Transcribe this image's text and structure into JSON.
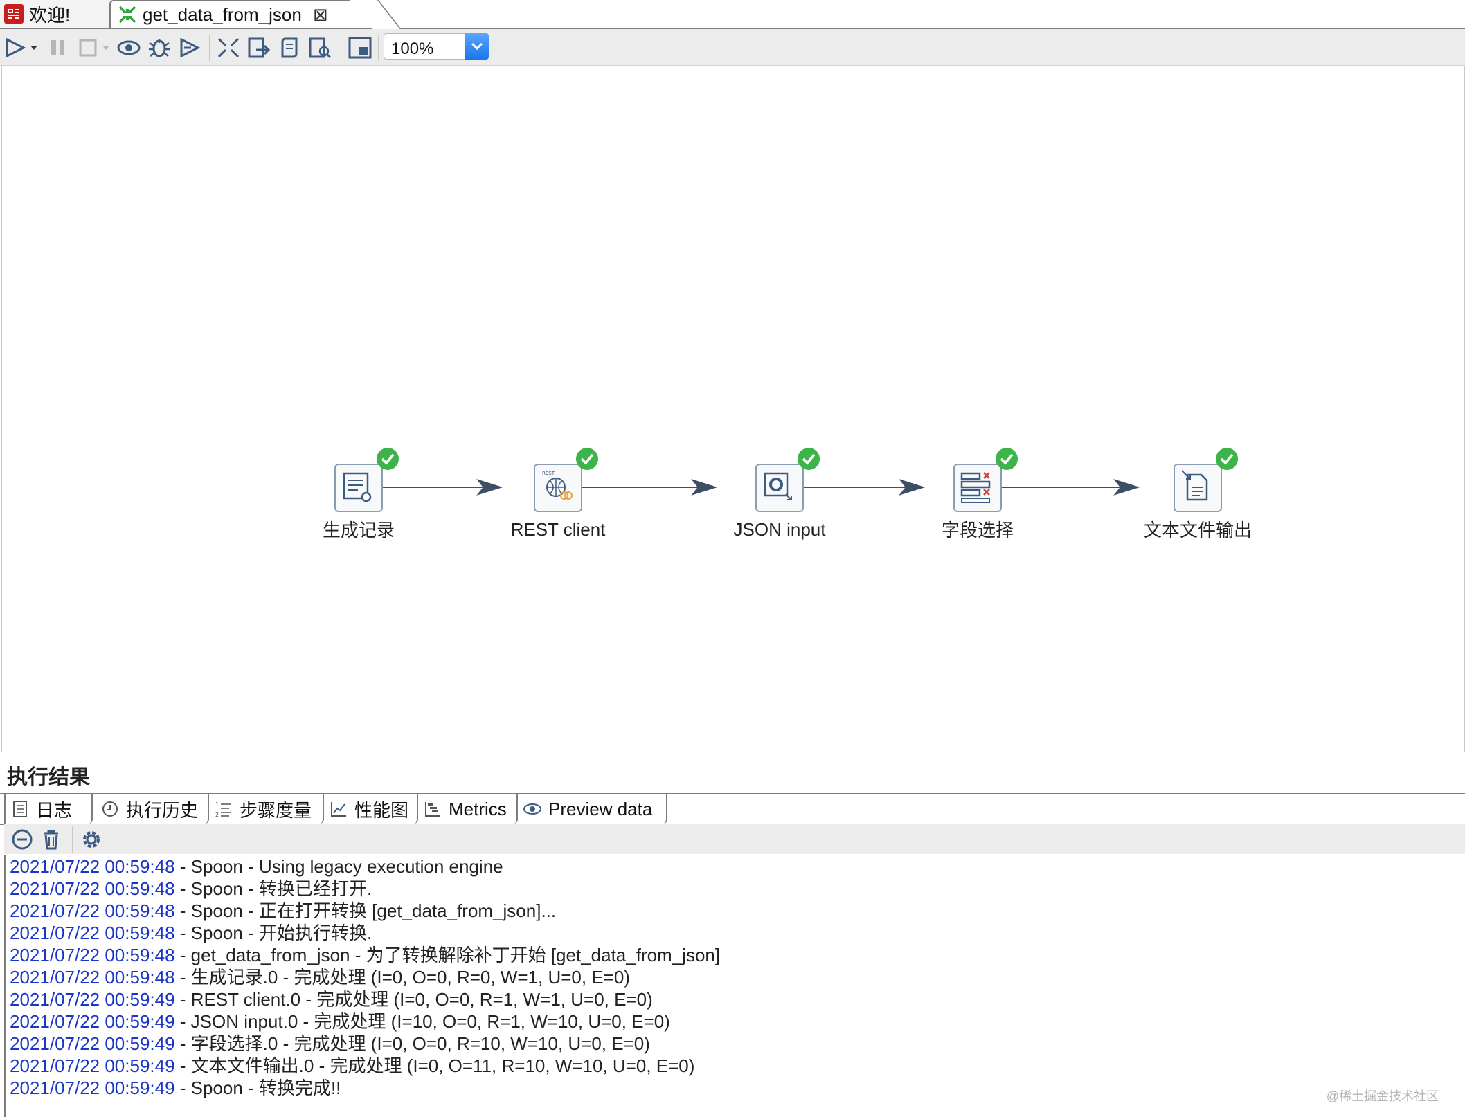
{
  "tabs": {
    "welcome": "欢迎!",
    "transformation": "get_data_from_json",
    "close_glyph": "⊠"
  },
  "toolbar": {
    "zoom_value": "100%",
    "buttons": [
      "run",
      "pause",
      "stop",
      "preview",
      "debug",
      "replay",
      "verify",
      "impact",
      "sql",
      "explore-db",
      "show-results"
    ]
  },
  "canvas": {
    "steps": [
      {
        "id": "generate-rows",
        "label": "生成记录",
        "status": "success"
      },
      {
        "id": "rest-client",
        "label": "REST client",
        "status": "success"
      },
      {
        "id": "json-input",
        "label": "JSON input",
        "status": "success"
      },
      {
        "id": "select-values",
        "label": "字段选择",
        "status": "success"
      },
      {
        "id": "text-file-output",
        "label": "文本文件输出",
        "status": "success"
      }
    ]
  },
  "results": {
    "title": "执行结果",
    "tabs": [
      "日志",
      "执行历史",
      "步骤度量",
      "性能图",
      "Metrics",
      "Preview data"
    ],
    "log": [
      {
        "ts": "2021/07/22 00:59:48",
        "msg": " - Spoon - Using legacy execution engine"
      },
      {
        "ts": "2021/07/22 00:59:48",
        "msg": " - Spoon - 转换已经打开."
      },
      {
        "ts": "2021/07/22 00:59:48",
        "msg": " - Spoon - 正在打开转换 [get_data_from_json]..."
      },
      {
        "ts": "2021/07/22 00:59:48",
        "msg": " - Spoon - 开始执行转换."
      },
      {
        "ts": "2021/07/22 00:59:48",
        "msg": " - get_data_from_json - 为了转换解除补丁开始  [get_data_from_json]"
      },
      {
        "ts": "2021/07/22 00:59:48",
        "msg": " - 生成记录.0 - 完成处理 (I=0, O=0, R=0, W=1, U=0, E=0)"
      },
      {
        "ts": "2021/07/22 00:59:49",
        "msg": " - REST client.0 - 完成处理 (I=0, O=0, R=1, W=1, U=0, E=0)"
      },
      {
        "ts": "2021/07/22 00:59:49",
        "msg": " - JSON input.0 - 完成处理 (I=10, O=0, R=1, W=10, U=0, E=0)"
      },
      {
        "ts": "2021/07/22 00:59:49",
        "msg": " - 字段选择.0 - 完成处理 (I=0, O=0, R=10, W=10, U=0, E=0)"
      },
      {
        "ts": "2021/07/22 00:59:49",
        "msg": " - 文本文件输出.0 - 完成处理 (I=0, O=11, R=10, W=10, U=0, E=0)"
      },
      {
        "ts": "2021/07/22 00:59:49",
        "msg": " - Spoon - 转换完成!!"
      }
    ]
  },
  "watermark": "@稀土掘金技术社区",
  "colors": {
    "log_timestamp": "#1a35c8",
    "success_check": "#3cb44a",
    "hop_arrow": "#3d4f66",
    "accent_dropdown": "#1c74ea"
  }
}
